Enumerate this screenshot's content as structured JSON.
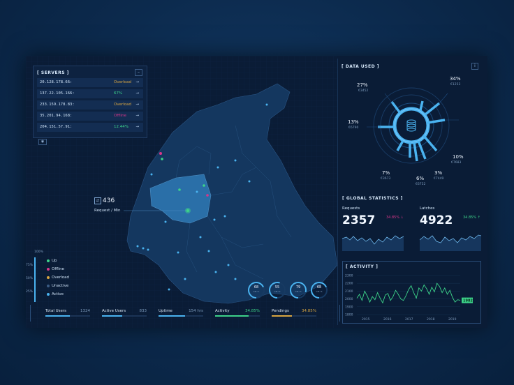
{
  "servers": {
    "title": "[ SERVERS ]",
    "rows": [
      {
        "ip": "20.128.178.66:",
        "status": "Overload",
        "color": "#d9a641"
      },
      {
        "ip": "137.22.105.166:",
        "status": "67%",
        "color": "#3dd38a"
      },
      {
        "ip": "233.159.178.83:",
        "status": "Overload",
        "color": "#d9a641"
      },
      {
        "ip": "35.201.94.168:",
        "status": "Offline",
        "color": "#d9368a"
      },
      {
        "ip": "204.151.57.91:",
        "status": "12.44%",
        "color": "#3dd38a"
      }
    ]
  },
  "map": {
    "callout_value": "436",
    "callout_label": "Request / Min",
    "legend_top": "100%",
    "legend_scale": [
      "75%",
      "50%",
      "25%"
    ],
    "legend": [
      {
        "label": "Up",
        "color": "#3dd38a"
      },
      {
        "label": "Offline",
        "color": "#d9368a"
      },
      {
        "label": "Overload",
        "color": "#d9a641"
      },
      {
        "label": "Unactive",
        "color": "#3a5b84"
      },
      {
        "label": "Active",
        "color": "#4ab3f0"
      }
    ],
    "gauges": [
      {
        "value": "68",
        "label": "CPU 1",
        "level": 0.68
      },
      {
        "value": "55",
        "label": "CPU 2",
        "level": 0.55
      },
      {
        "value": "79",
        "label": "CPU 3",
        "level": 0.79
      },
      {
        "value": "68",
        "label": "CPU 4",
        "level": 0.68
      }
    ]
  },
  "bottom": [
    {
      "label": "Total Users",
      "value": "1324",
      "fill": 0.55,
      "color": "#4ab3f0"
    },
    {
      "label": "Active Users",
      "value": "833",
      "fill": 0.45,
      "color": "#4ab3f0"
    },
    {
      "label": "Uptime",
      "value": "154 hrs",
      "fill": 0.6,
      "color": "#4ab3f0"
    },
    {
      "label": "Activity",
      "value": "34.85%",
      "fill": 0.75,
      "color": "#3dd38a"
    },
    {
      "label": "Pendings",
      "value": "34.85%",
      "fill": 0.45,
      "color": "#d9a641"
    }
  ],
  "data_used": {
    "title": "[ DATA USED ]",
    "info_icon": "i",
    "segments": [
      {
        "pct": "27%",
        "val": "€3452"
      },
      {
        "pct": "34%",
        "val": "€1253"
      },
      {
        "pct": "13%",
        "val": "€6790"
      },
      {
        "pct": "10%",
        "val": "€7683"
      },
      {
        "pct": "7%",
        "val": "€3673"
      },
      {
        "pct": "6%",
        "val": "€6752"
      },
      {
        "pct": "3%",
        "val": "€7449"
      }
    ]
  },
  "global": {
    "title": "[ GLOBAL STATISTICS ]",
    "requests_label": "Requests",
    "requests_value": "2357",
    "requests_change": "34.85% ↓",
    "requests_color": "#d9368a",
    "latches_label": "Latches",
    "latches_value": "4922",
    "latches_change": "34.85% ↑",
    "latches_color": "#3dd38a"
  },
  "activity": {
    "title": "[ ACTIVITY ]",
    "current": "1982",
    "chart_data": {
      "type": "line",
      "x_ticks": [
        "2015",
        "2016",
        "2017",
        "2018",
        "2019"
      ],
      "y_ticks": [
        "2300",
        "2200",
        "2100",
        "2000",
        "1900",
        "1800"
      ],
      "ylim": [
        1800,
        2300
      ],
      "values": [
        2010,
        2060,
        1980,
        2100,
        2040,
        1960,
        2030,
        1990,
        2080,
        2010,
        1950,
        2050,
        2070,
        1980,
        2030,
        2110,
        2060,
        2000,
        1980,
        2040,
        2120,
        2170,
        2080,
        2010,
        2140,
        2100,
        2180,
        2130,
        2060,
        2150,
        2090,
        2200,
        2160,
        2080,
        2140,
        2060,
        2110,
        2020,
        1960,
        1990,
        1982
      ]
    }
  }
}
